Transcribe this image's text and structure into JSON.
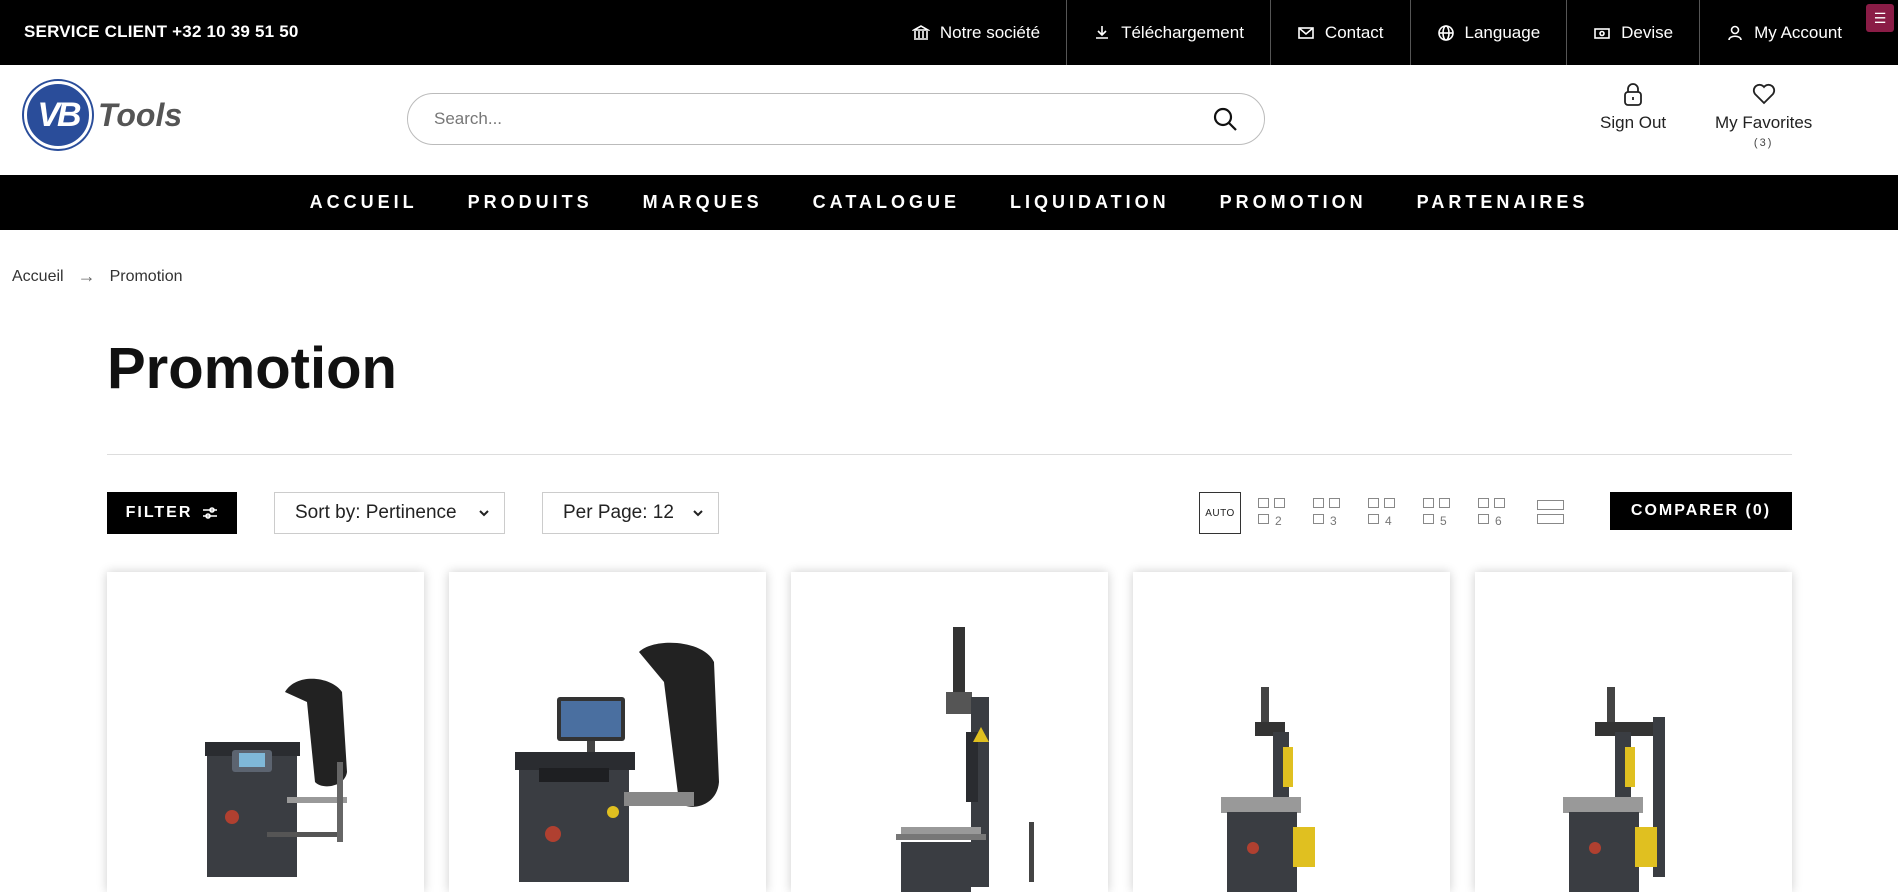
{
  "topbar": {
    "service": "SERVICE CLIENT +32 10 39 51 50",
    "links": [
      {
        "label": "Notre société",
        "icon": "bank-icon"
      },
      {
        "label": "Téléchargement",
        "icon": "download-icon"
      },
      {
        "label": "Contact",
        "icon": "mail-icon"
      },
      {
        "label": "Language",
        "icon": "globe-icon"
      },
      {
        "label": "Devise",
        "icon": "currency-icon"
      },
      {
        "label": "My Account",
        "icon": "user-icon"
      }
    ],
    "menu_glyph": "☰"
  },
  "header": {
    "logo_mark": "VB",
    "logo_text": "Tools",
    "search_placeholder": "Search...",
    "sign_out": "Sign Out",
    "favorites": "My Favorites",
    "favorites_count": "(3)"
  },
  "nav": [
    "ACCUEIL",
    "PRODUITS",
    "MARQUES",
    "CATALOGUE",
    "LIQUIDATION",
    "PROMOTION",
    "PARTENAIRES"
  ],
  "breadcrumb": {
    "home": "Accueil",
    "sep": "→",
    "current": "Promotion"
  },
  "page_title": "Promotion",
  "toolbar": {
    "filter": "FILTER",
    "sort": "Sort by: Pertinence",
    "per_page": "Per Page: 12",
    "grid_options": [
      "AUTO",
      "2",
      "3",
      "4",
      "5",
      "6"
    ],
    "compare": "COMPARER (0)"
  },
  "products": [
    {
      "name": "wheel-balancer-small"
    },
    {
      "name": "wheel-balancer-screen"
    },
    {
      "name": "tyre-changer-tall"
    },
    {
      "name": "tyre-changer-helper"
    },
    {
      "name": "tyre-changer-double-helper"
    }
  ],
  "colors": {
    "brand": "#2a4d9a",
    "accent_menu": "#8a1c46",
    "bar": "#000000"
  }
}
